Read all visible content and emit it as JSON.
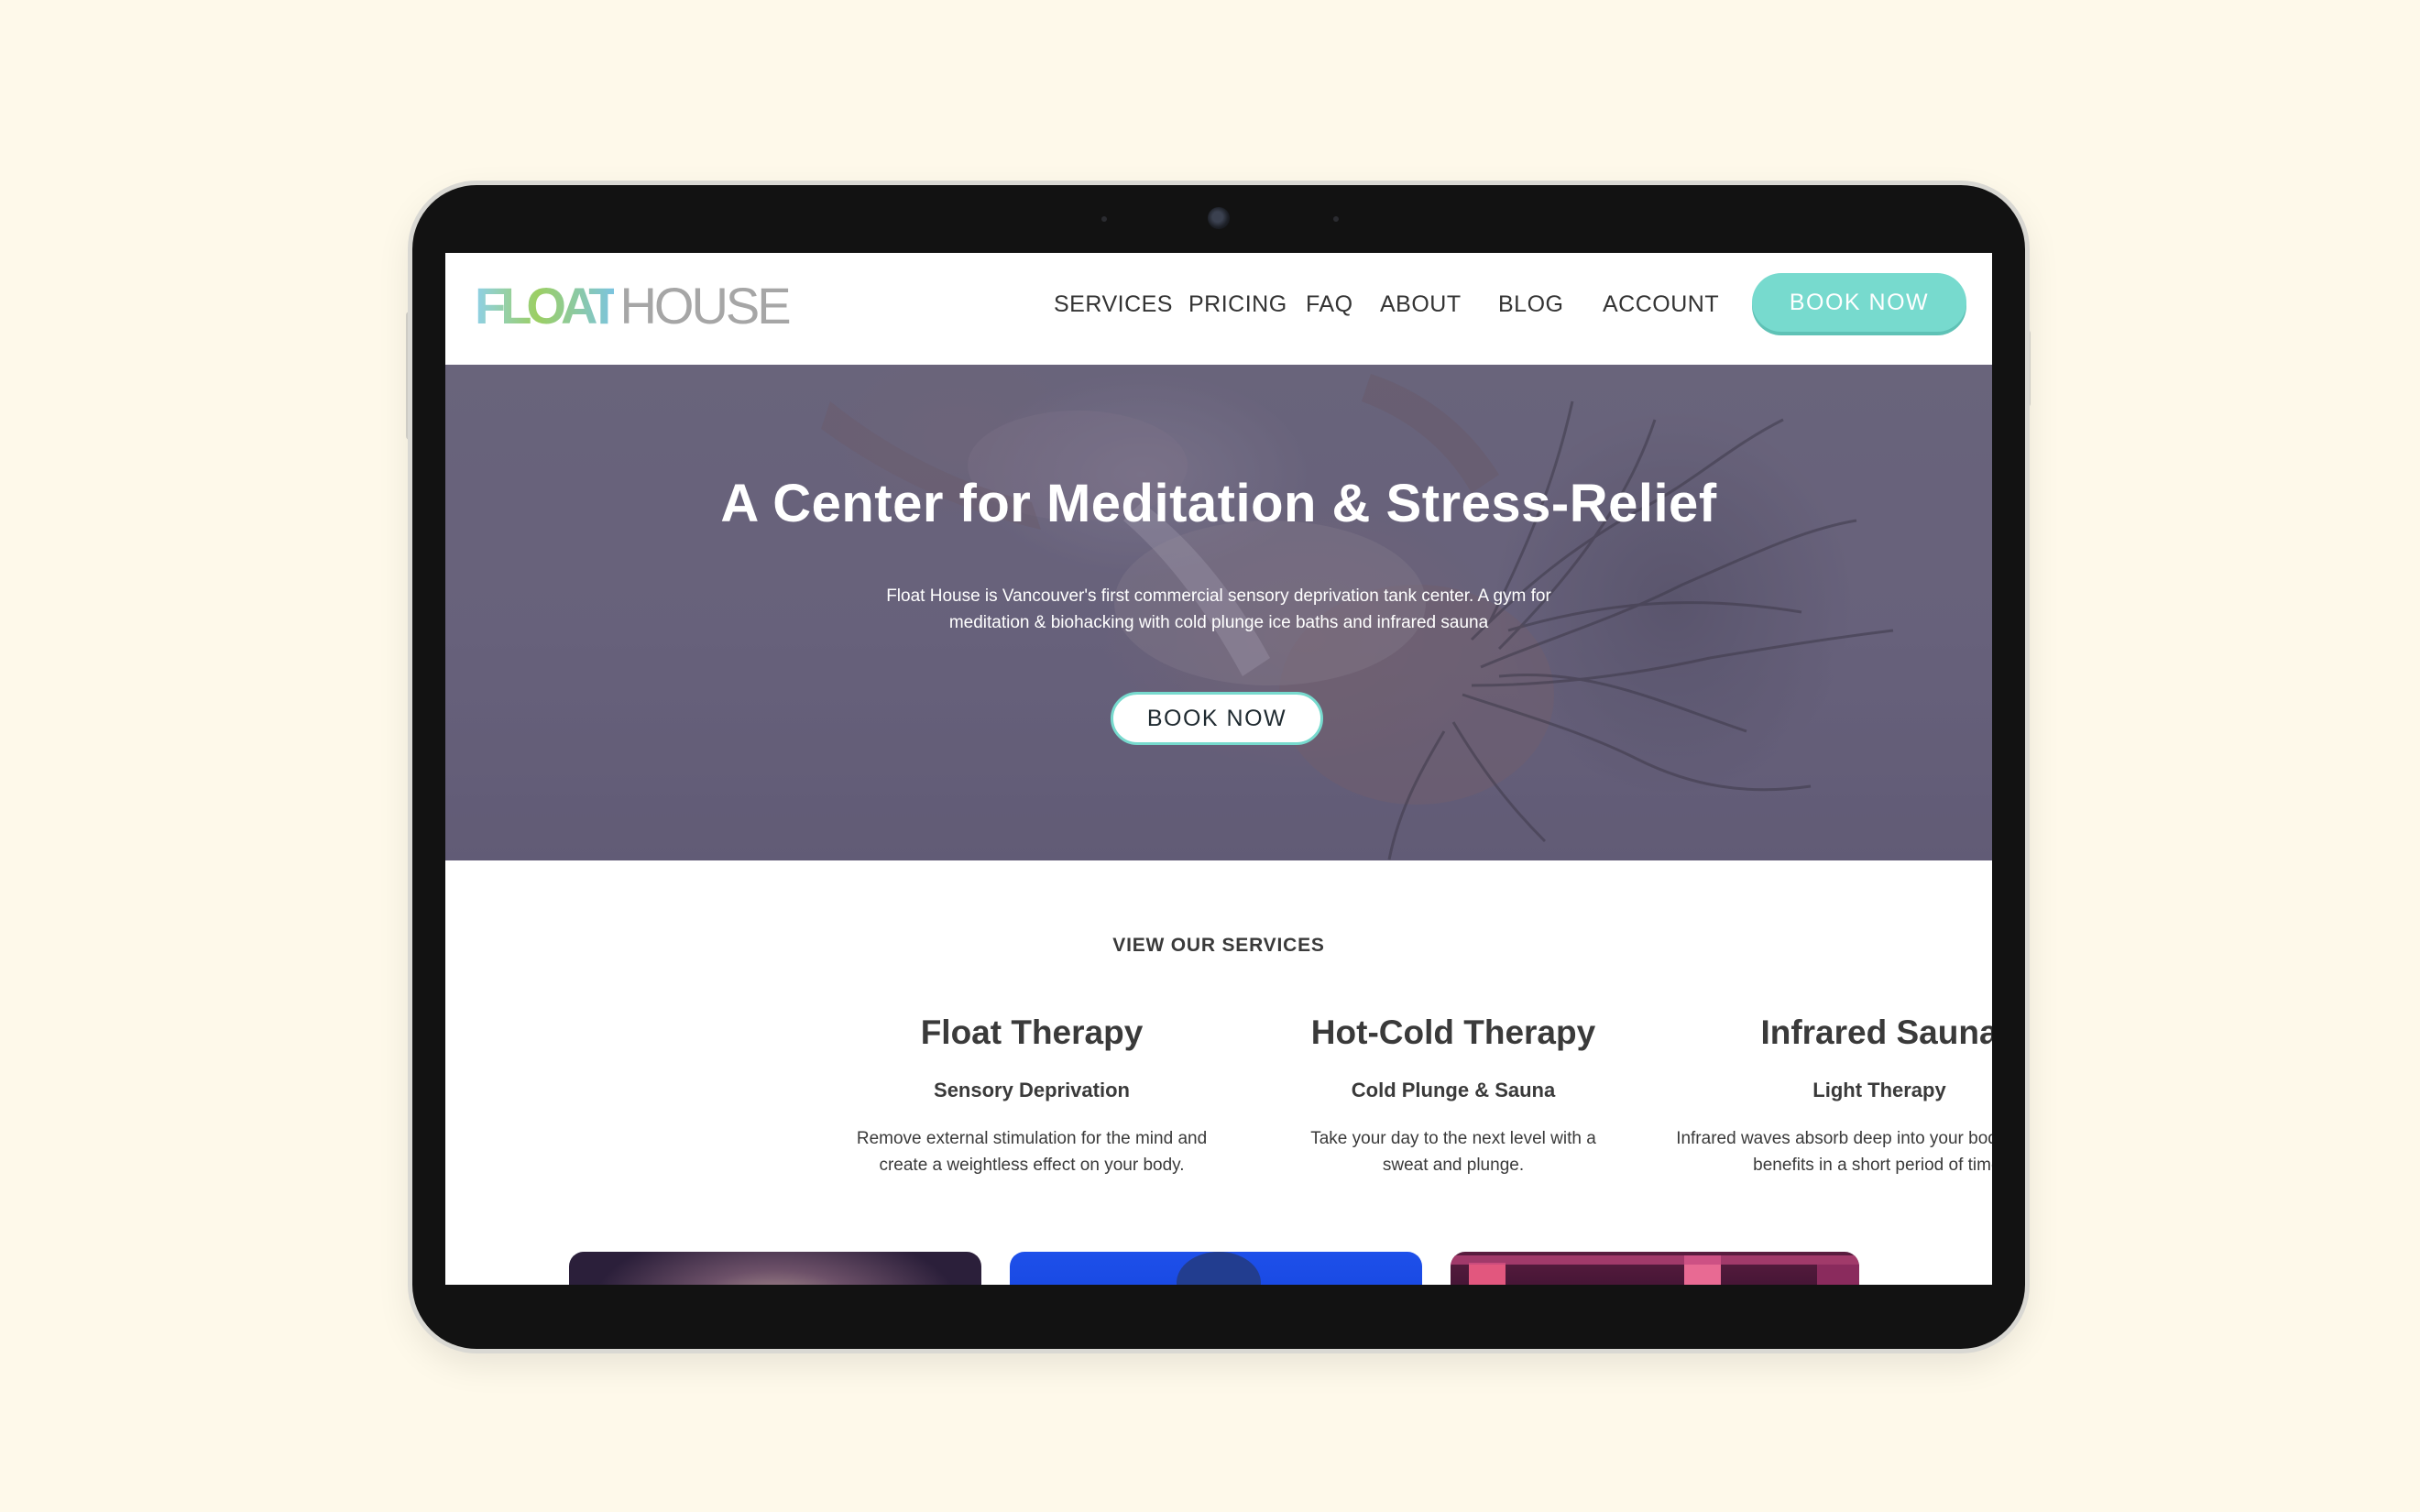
{
  "brand": {
    "logo_float": "FLOAT",
    "logo_house": "HOUSE"
  },
  "nav": {
    "items": [
      {
        "label": "SERVICES"
      },
      {
        "label": "PRICING"
      },
      {
        "label": "FAQ"
      },
      {
        "label": "ABOUT"
      },
      {
        "label": "BLOG"
      },
      {
        "label": "ACCOUNT"
      }
    ],
    "book_label": "BOOK NOW"
  },
  "hero": {
    "title": "A Center for Meditation & Stress-Relief",
    "subtitle": "Float House is Vancouver's first commercial sensory deprivation tank center. A gym for meditation & biohacking with cold plunge ice baths and infrared sauna",
    "book_label": "BOOK NOW"
  },
  "services": {
    "heading": "VIEW OUR SERVICES",
    "items": [
      {
        "title": "Float Therapy",
        "subtitle": "Sensory Deprivation",
        "description": "Remove external stimulation for the mind and create a weightless effect on your body."
      },
      {
        "title": "Hot-Cold Therapy",
        "subtitle": "Cold Plunge & Sauna",
        "description": "Take your day to the next level with a sweat and plunge."
      },
      {
        "title": "Infrared Sauna",
        "subtitle": "Light Therapy",
        "description": "Infrared waves absorb deep into your body to get big benefits in a short period of time."
      }
    ]
  },
  "colors": {
    "page_background": "#fef9ea",
    "accent": "#77dace",
    "text": "#3a3a3a",
    "hero_tint": "#6c6680"
  },
  "icons": {
    "camera": "front-camera-icon"
  }
}
